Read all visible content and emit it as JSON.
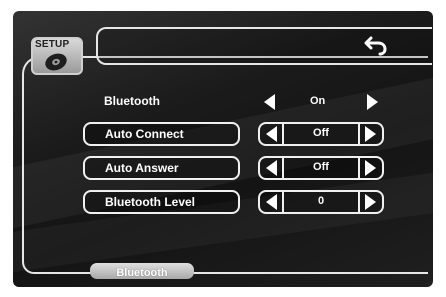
{
  "header": {
    "setup_tab_label": "SETUP"
  },
  "settings": {
    "bluetooth": {
      "label": "Bluetooth",
      "value": "On"
    },
    "auto_connect": {
      "label": "Auto Connect",
      "value": "Off"
    },
    "auto_answer": {
      "label": "Auto Answer",
      "value": "Off"
    },
    "bluetooth_level": {
      "label": "Bluetooth Level",
      "value": "0"
    }
  },
  "footer": {
    "tab_label": "Bluetooth"
  },
  "icons": {
    "back": "back-arrow-icon",
    "setup": "cd-disc-icon",
    "prev": "triangle-left-icon",
    "next": "triangle-right-icon"
  },
  "colors": {
    "panel_background": "#1b1b1b",
    "text": "#ffffff",
    "tab_gray": "#b0b0b0"
  }
}
